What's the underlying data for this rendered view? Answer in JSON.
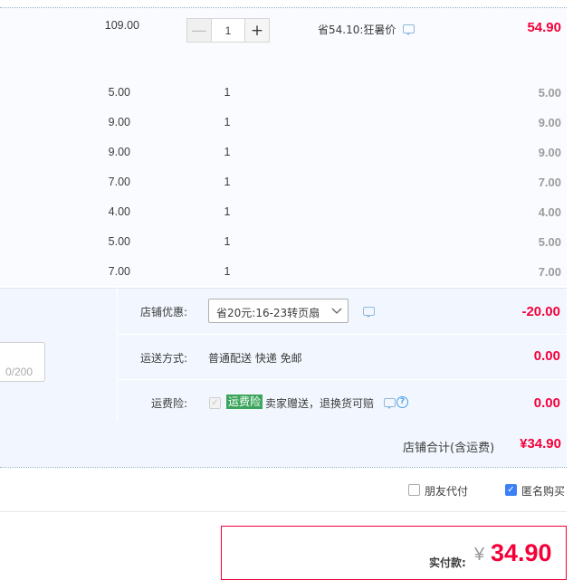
{
  "main_item": {
    "unit_price": "109.00",
    "quantity": "1",
    "minus_symbol": "—",
    "plus_symbol": "+",
    "discount_note": "省54.10:狂暑价",
    "subtotal": "54.90"
  },
  "items": [
    {
      "price": "5.00",
      "qty": "1",
      "subtotal": "5.00"
    },
    {
      "price": "9.00",
      "qty": "1",
      "subtotal": "9.00"
    },
    {
      "price": "9.00",
      "qty": "1",
      "subtotal": "9.00"
    },
    {
      "price": "7.00",
      "qty": "1",
      "subtotal": "7.00"
    },
    {
      "price": "4.00",
      "qty": "1",
      "subtotal": "4.00"
    },
    {
      "price": "5.00",
      "qty": "1",
      "subtotal": "5.00"
    },
    {
      "price": "7.00",
      "qty": "1",
      "subtotal": "7.00"
    }
  ],
  "message": {
    "counter": "0/200"
  },
  "store_discount": {
    "label": "店铺优惠:",
    "selected": "省20元:16-23转页扇",
    "amount": "-20.00"
  },
  "shipping": {
    "label": "运送方式:",
    "value": "普通配送 快递 免邮",
    "amount": "0.00"
  },
  "insurance": {
    "label": "运费险:",
    "badge": "运费险",
    "text": "卖家赠送，退换货可赔",
    "amount": "0.00"
  },
  "store_total": {
    "label": "店铺合计(含运费)",
    "amount": "¥34.90"
  },
  "options": {
    "friend_pay": "朋友代付",
    "anonymous": "匿名购买"
  },
  "payment": {
    "label": "实付款:",
    "currency": "¥",
    "amount": "34.90"
  },
  "colors": {
    "accent_red": "#f40039",
    "badge_green": "#3ca55c",
    "checkbox_blue": "#3b80f6"
  }
}
